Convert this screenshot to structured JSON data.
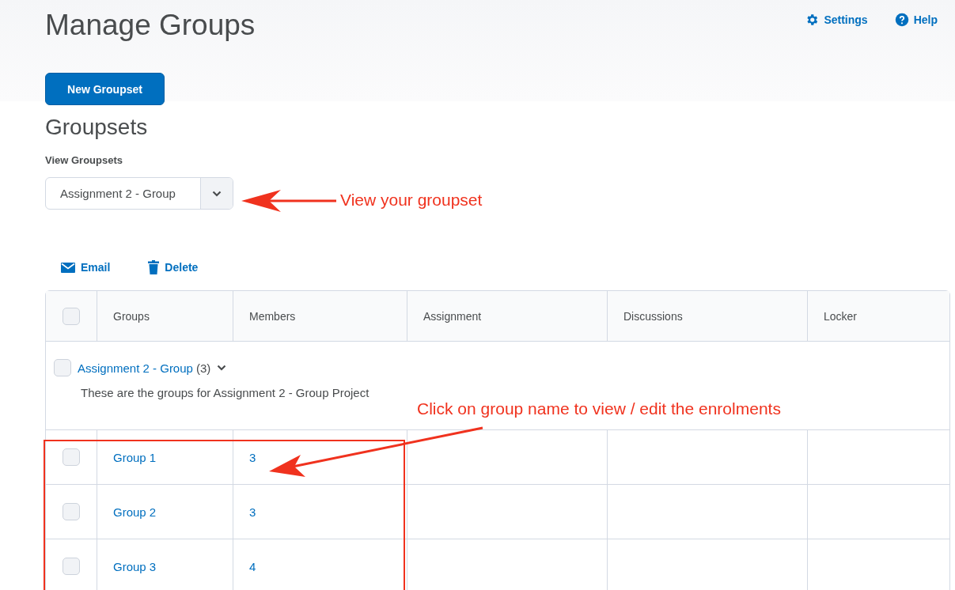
{
  "header": {
    "title": "Manage Groups",
    "links": [
      {
        "kind": "settings",
        "label": "Settings"
      },
      {
        "kind": "help",
        "label": "Help"
      }
    ]
  },
  "new_button": "New Groupset",
  "section_title": "Groupsets",
  "view_groupsets": {
    "label": "View Groupsets",
    "value": "Assignment 2 - Group"
  },
  "toolbar": [
    {
      "kind": "email",
      "label": "Email"
    },
    {
      "kind": "delete",
      "label": "Delete"
    }
  ],
  "table": {
    "select_all_checked": false,
    "columns": [
      "Groups",
      "Members",
      "Assignment",
      "Discussions",
      "Locker"
    ],
    "groupset": {
      "name": "Assignment 2 - Group",
      "count": "(3)",
      "description": "These are the groups for Assignment 2 - Group Project",
      "checked": false,
      "expanded": true
    },
    "rows": [
      {
        "name": "Group 1",
        "members": "3",
        "checked": false
      },
      {
        "name": "Group 2",
        "members": "3",
        "checked": false
      },
      {
        "name": "Group 3",
        "members": "4",
        "checked": false
      }
    ]
  },
  "annotations": [
    "View your groupset",
    "Click on group name to view / edit the enrolments"
  ]
}
